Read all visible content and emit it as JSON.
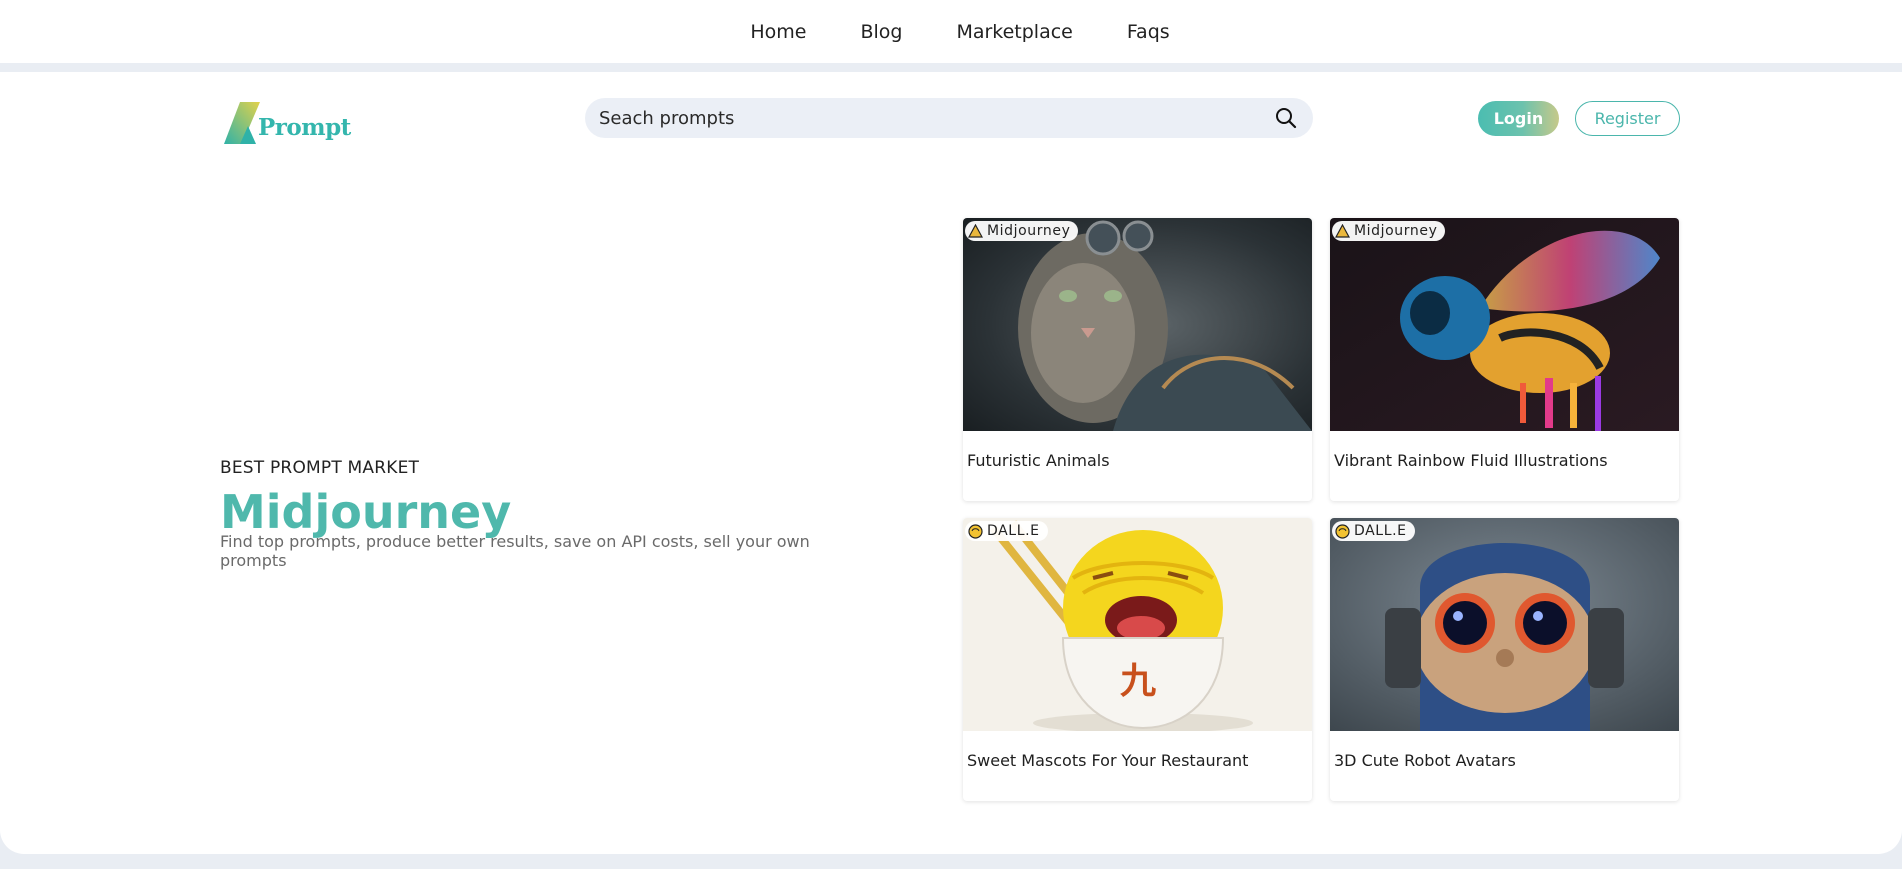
{
  "nav": {
    "items": [
      "Home",
      "Blog",
      "Marketplace",
      "Faqs"
    ]
  },
  "logo": {
    "text": "Prompt"
  },
  "search": {
    "placeholder": "Seach prompts"
  },
  "auth": {
    "login_label": "Login",
    "register_label": "Register"
  },
  "hero": {
    "eyebrow": "BEST PROMPT MARKET",
    "headline": "Midjourney",
    "description": "Find top prompts, produce better results, save on API costs, sell your own prompts"
  },
  "cards": [
    {
      "badge": "Midjourney",
      "badge_icon": "midjourney-icon",
      "title": "Futuristic Animals",
      "image": "cyberpunk-cat"
    },
    {
      "badge": "Midjourney",
      "badge_icon": "midjourney-icon",
      "title": "Vibrant Rainbow Fluid Illustrations",
      "image": "rainbow-bee"
    },
    {
      "badge": "DALL.E",
      "badge_icon": "dalle-icon",
      "title": "Sweet Mascots For Your Restaurant",
      "image": "noodle-mascot"
    },
    {
      "badge": "DALL.E",
      "badge_icon": "dalle-icon",
      "title": "3D Cute Robot Avatars",
      "image": "robot-avatar"
    }
  ],
  "colors": {
    "accent": "#4fb8ac",
    "search_bg": "#ebeff6",
    "page_bg": "#e9edf3"
  }
}
